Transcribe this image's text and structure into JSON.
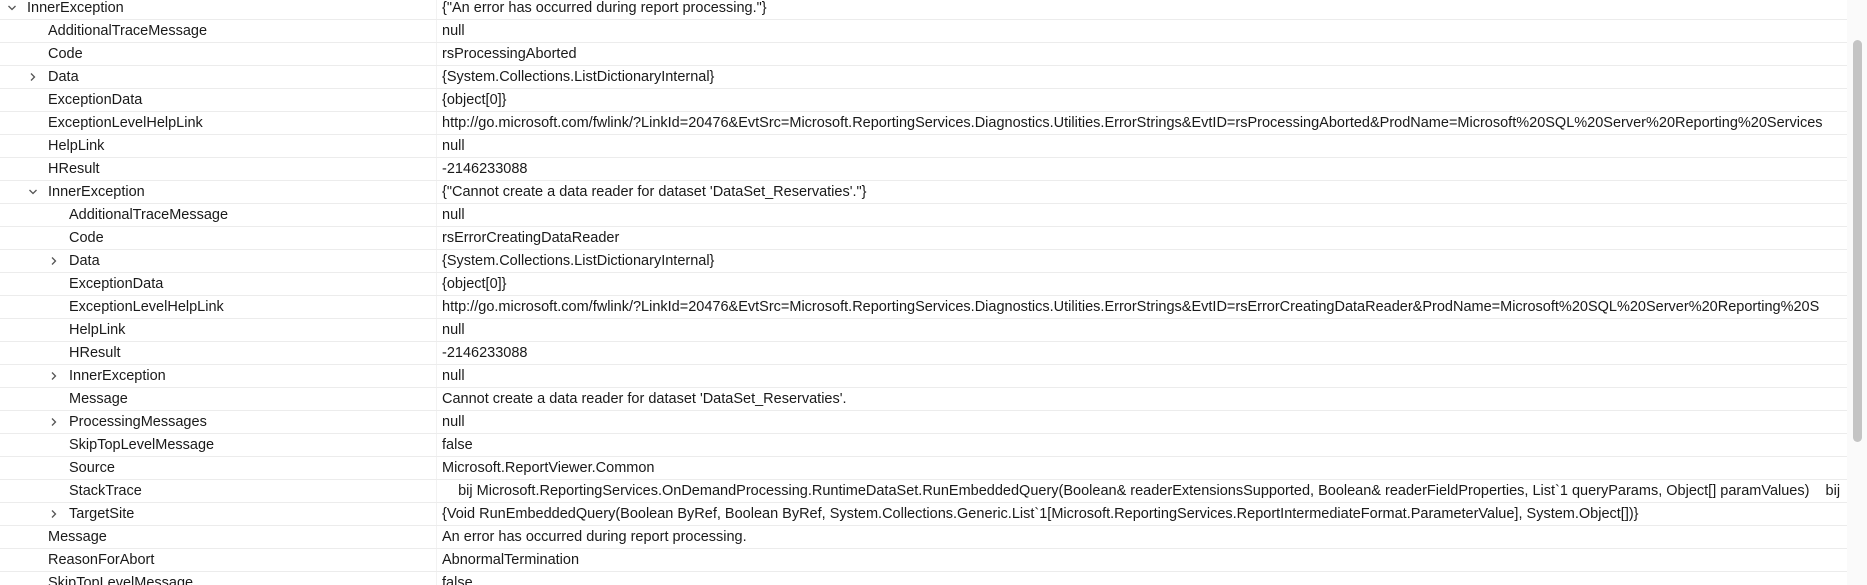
{
  "rows": [
    {
      "level": 0,
      "expander": "expanded",
      "name": "InnerException",
      "value": "{\"An error has occurred during report processing.\"}"
    },
    {
      "level": 1,
      "expander": "none",
      "name": "AdditionalTraceMessage",
      "value": "null"
    },
    {
      "level": 1,
      "expander": "none",
      "name": "Code",
      "value": "rsProcessingAborted"
    },
    {
      "level": 1,
      "expander": "collapsed",
      "name": "Data",
      "value": "{System.Collections.ListDictionaryInternal}"
    },
    {
      "level": 1,
      "expander": "none",
      "name": "ExceptionData",
      "value": "{object[0]}"
    },
    {
      "level": 1,
      "expander": "none",
      "name": "ExceptionLevelHelpLink",
      "value": "http://go.microsoft.com/fwlink/?LinkId=20476&EvtSrc=Microsoft.ReportingServices.Diagnostics.Utilities.ErrorStrings&EvtID=rsProcessingAborted&ProdName=Microsoft%20SQL%20Server%20Reporting%20Services"
    },
    {
      "level": 1,
      "expander": "none",
      "name": "HelpLink",
      "value": "null"
    },
    {
      "level": 1,
      "expander": "none",
      "name": "HResult",
      "value": "-2146233088"
    },
    {
      "level": 1,
      "expander": "expanded",
      "name": "InnerException",
      "value": "{\"Cannot create a data reader for dataset 'DataSet_Reservaties'.\"}"
    },
    {
      "level": 2,
      "expander": "none",
      "name": "AdditionalTraceMessage",
      "value": "null"
    },
    {
      "level": 2,
      "expander": "none",
      "name": "Code",
      "value": "rsErrorCreatingDataReader"
    },
    {
      "level": 2,
      "expander": "collapsed",
      "name": "Data",
      "value": "{System.Collections.ListDictionaryInternal}"
    },
    {
      "level": 2,
      "expander": "none",
      "name": "ExceptionData",
      "value": "{object[0]}"
    },
    {
      "level": 2,
      "expander": "none",
      "name": "ExceptionLevelHelpLink",
      "value": "http://go.microsoft.com/fwlink/?LinkId=20476&EvtSrc=Microsoft.ReportingServices.Diagnostics.Utilities.ErrorStrings&EvtID=rsErrorCreatingDataReader&ProdName=Microsoft%20SQL%20Server%20Reporting%20S"
    },
    {
      "level": 2,
      "expander": "none",
      "name": "HelpLink",
      "value": "null"
    },
    {
      "level": 2,
      "expander": "none",
      "name": "HResult",
      "value": "-2146233088"
    },
    {
      "level": 2,
      "expander": "collapsed",
      "name": "InnerException",
      "value": "null"
    },
    {
      "level": 2,
      "expander": "none",
      "name": "Message",
      "value": "Cannot create a data reader for dataset 'DataSet_Reservaties'."
    },
    {
      "level": 2,
      "expander": "collapsed",
      "name": "ProcessingMessages",
      "value": "null"
    },
    {
      "level": 2,
      "expander": "none",
      "name": "SkipTopLevelMessage",
      "value": "false"
    },
    {
      "level": 2,
      "expander": "none",
      "name": "Source",
      "value": "Microsoft.ReportViewer.Common"
    },
    {
      "level": 2,
      "expander": "none",
      "name": "StackTrace",
      "value": "    bij Microsoft.ReportingServices.OnDemandProcessing.RuntimeDataSet.RunEmbeddedQuery(Boolean& readerExtensionsSupported, Boolean& readerFieldProperties, List`1 queryParams, Object[] paramValues)    bij"
    },
    {
      "level": 2,
      "expander": "collapsed",
      "name": "TargetSite",
      "value": "{Void RunEmbeddedQuery(Boolean ByRef, Boolean ByRef, System.Collections.Generic.List`1[Microsoft.ReportingServices.ReportIntermediateFormat.ParameterValue], System.Object[])}"
    },
    {
      "level": 1,
      "expander": "none",
      "name": "Message",
      "value": "An error has occurred during report processing."
    },
    {
      "level": 1,
      "expander": "none",
      "name": "ReasonForAbort",
      "value": "AbnormalTermination"
    },
    {
      "level": 1,
      "expander": "none",
      "name": "SkipTopLevelMessage",
      "value": "false"
    }
  ]
}
